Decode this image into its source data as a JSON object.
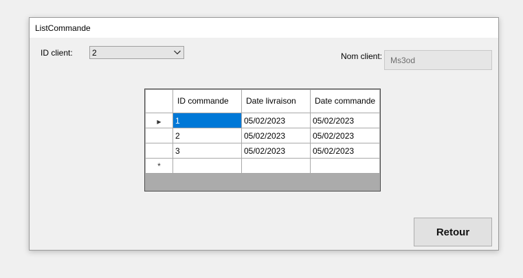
{
  "window": {
    "title": "ListCommande"
  },
  "form": {
    "id_client_label": "ID client:",
    "id_client_value": "2",
    "nom_client_label": "Nom client:",
    "nom_client_value": "Ms3od"
  },
  "grid": {
    "columns": [
      "ID commande",
      "Date livraison",
      "Date commande"
    ],
    "rows": [
      [
        "1",
        "05/02/2023",
        "05/02/2023"
      ],
      [
        "2",
        "05/02/2023",
        "05/02/2023"
      ],
      [
        "3",
        "05/02/2023",
        "05/02/2023"
      ]
    ],
    "new_row_marker": "*",
    "current_row_marker": "▶",
    "selected_row": 0
  },
  "buttons": {
    "retour_label": "Retour"
  },
  "icons": {
    "combo_arrow": "chevron-down-icon",
    "current_row": "row-pointer-icon",
    "new_row": "new-row-icon"
  }
}
